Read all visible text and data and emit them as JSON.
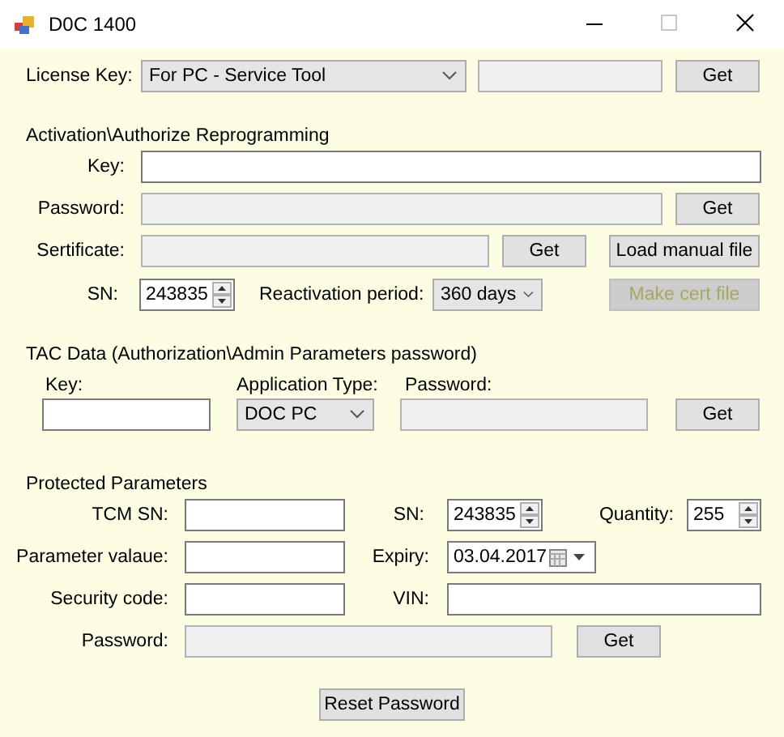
{
  "window": {
    "title": "D0C 1400"
  },
  "license": {
    "label": "License Key:",
    "type": {
      "value": "For PC - Service Tool"
    },
    "key_field": {
      "disabled": true
    },
    "button": "Get"
  },
  "activation": {
    "heading": "Activation\\Authorize Reprogramming",
    "key": {
      "label": "Key:",
      "disabled": false
    },
    "password": {
      "label": "Password:",
      "disabled": true,
      "button": "Get"
    },
    "certificate": {
      "label": "Sertificate:",
      "disabled": true,
      "button": "Get",
      "load_button": "Load manual file"
    },
    "sn": {
      "label": "SN:",
      "value": "243835"
    },
    "period": {
      "label": "Reactivation period:",
      "value": "360 days"
    },
    "make_cert": {
      "label": "Make cert file",
      "disabled": true
    }
  },
  "tac": {
    "heading": "TAC Data (Authorization\\Admin Parameters password)",
    "key": {
      "label": "Key:",
      "disabled": false
    },
    "application_type": {
      "label": "Application Type:",
      "value": "DOC PC"
    },
    "password": {
      "label": "Password:",
      "disabled": true
    },
    "button": "Get"
  },
  "protected": {
    "heading": "Protected Parameters",
    "tcm_sn": {
      "label": "TCM SN:",
      "disabled": false
    },
    "sn": {
      "label": "SN:",
      "value": "243835"
    },
    "quantity": {
      "label": "Quantity:",
      "value": "255"
    },
    "parameter_value": {
      "label": "Parameter valaue:",
      "disabled": false
    },
    "expiry": {
      "label": "Expiry:",
      "value": "03.04.2017"
    },
    "security_code": {
      "label": "Security code:",
      "disabled": false
    },
    "vin": {
      "label": "VIN:",
      "disabled": false
    },
    "password": {
      "label": "Password:",
      "disabled": true,
      "button": "Get"
    }
  },
  "reset_button": "Reset Password"
}
